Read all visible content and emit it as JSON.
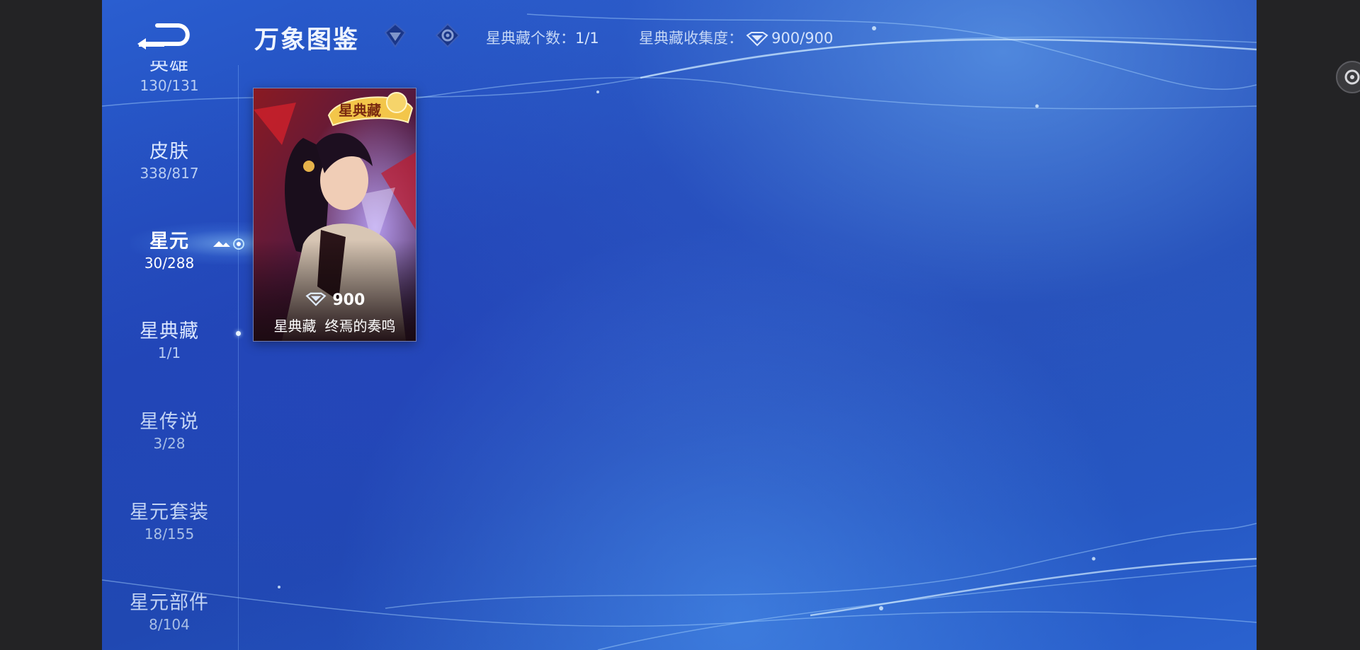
{
  "header": {
    "title": "万象图鉴",
    "stats": [
      {
        "label": "星典藏个数：",
        "value": "1/1"
      },
      {
        "label": "星典藏收集度：",
        "value": "900/900"
      }
    ]
  },
  "sidebar": {
    "items": [
      {
        "label": "英雄",
        "count": "130/131"
      },
      {
        "label": "皮肤",
        "count": "338/817"
      },
      {
        "label": "星元",
        "count": "30/288"
      },
      {
        "label": "星典藏",
        "count": "1/1"
      },
      {
        "label": "星传说",
        "count": "3/28"
      },
      {
        "label": "星元套装",
        "count": "18/155"
      },
      {
        "label": "星元部件",
        "count": "8/104"
      }
    ],
    "active_index": 2
  },
  "card": {
    "badge": "星典藏",
    "price": "900",
    "category": "星典藏",
    "name": "终焉的奏鸣"
  },
  "colors": {
    "accent": "#9fd4ff",
    "background": "#2048b2",
    "card_border": "#d9a85a"
  },
  "icons": [
    "back-icon",
    "diamond-filter-icon",
    "eye-filter-icon",
    "gem-icon",
    "settings-icon"
  ]
}
